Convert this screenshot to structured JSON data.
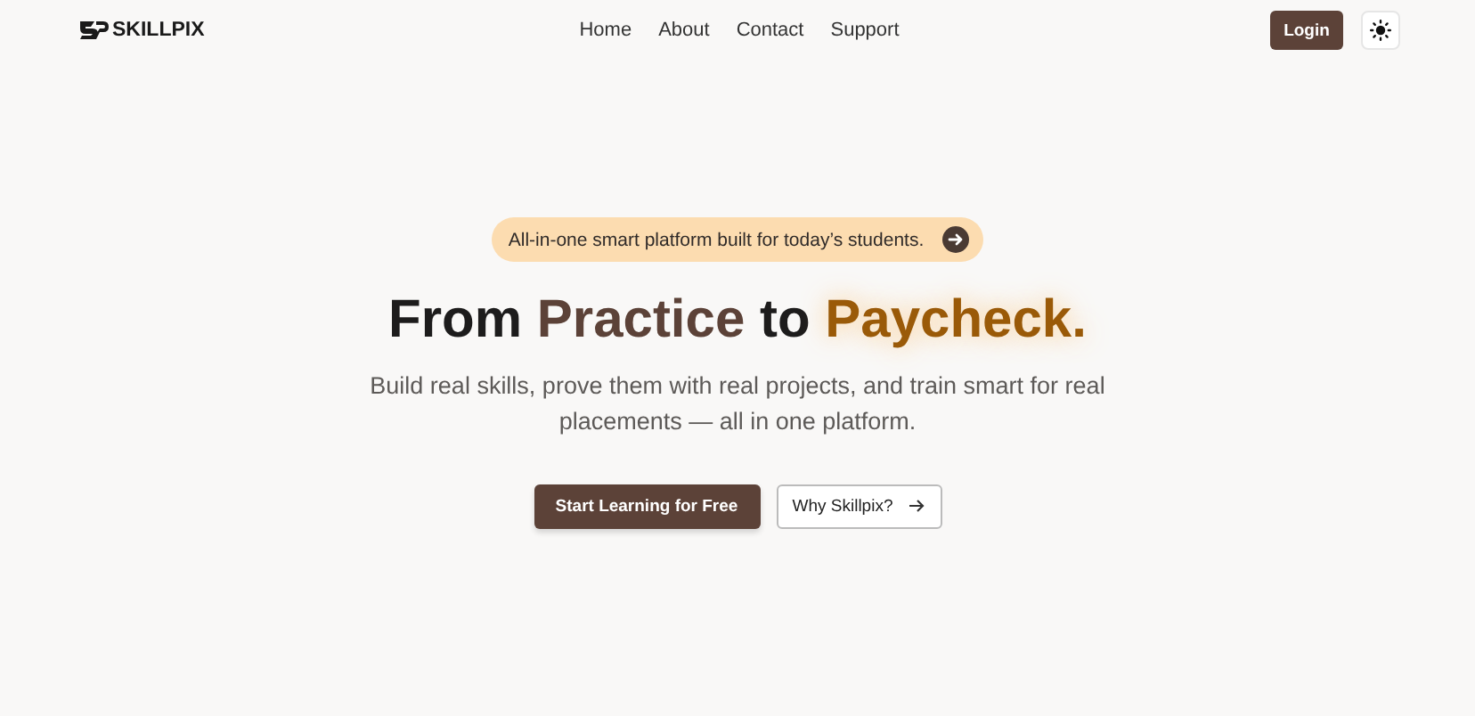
{
  "brand": {
    "name": "SKILLPIX"
  },
  "nav": [
    "Home",
    "About",
    "Contact",
    "Support"
  ],
  "header_actions": {
    "login": "Login"
  },
  "announcement": {
    "text": "All-in-one smart platform built for today’s students."
  },
  "headline": [
    {
      "text": "From",
      "kind": "plain"
    },
    {
      "text": "Practice",
      "kind": "accent"
    },
    {
      "text": "to",
      "kind": "plain"
    },
    {
      "text": "Paycheck.",
      "kind": "glow"
    }
  ],
  "subtitle": "Build real skills, prove them with real projects, and train smart for real placements — all in one platform.",
  "buttons": [
    {
      "label": "Start Learning for Free",
      "kind": "primary"
    },
    {
      "label": "Why Skillpix?",
      "kind": "secondary"
    }
  ]
}
